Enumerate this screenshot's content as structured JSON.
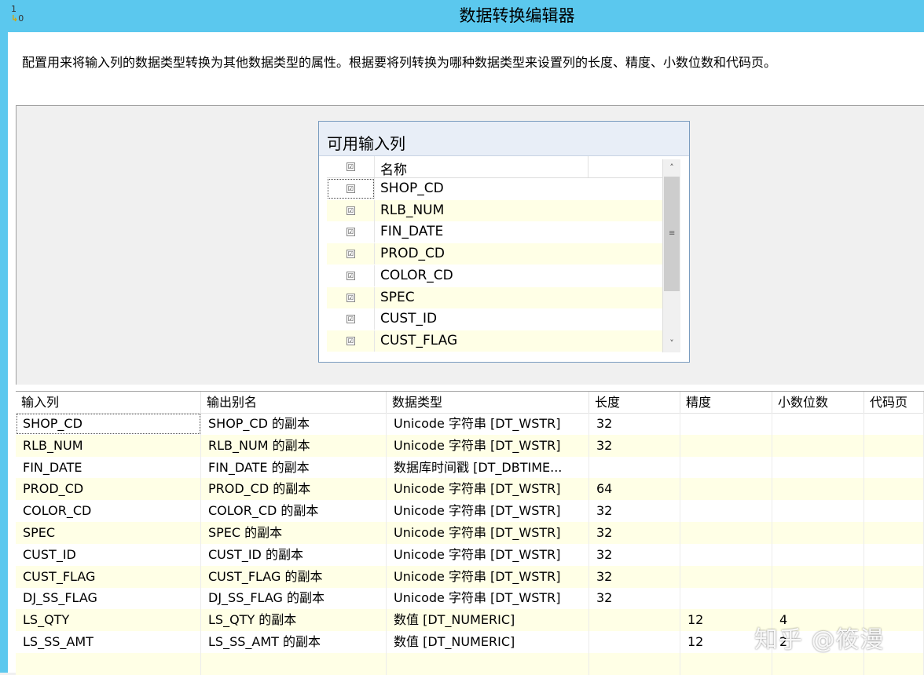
{
  "window": {
    "title": "数据转换编辑器",
    "icon_label": "1",
    "icon_sub": "0"
  },
  "description": "配置用来将输入列的数据类型转换为其他数据类型的属性。根据要将列转换为哪种数据类型来设置列的长度、精度、小数位数和代码页。",
  "available_inputs": {
    "title": "可用输入列",
    "header_name": "名称",
    "check_mark": "☑",
    "items": [
      "SHOP_CD",
      "RLB_NUM",
      "FIN_DATE",
      "PROD_CD",
      "COLOR_CD",
      "SPEC",
      "CUST_ID",
      "CUST_FLAG"
    ],
    "scroll_up": "˄",
    "scroll_down": "˅",
    "scroll_grip": "≡"
  },
  "grid": {
    "columns": [
      "输入列",
      "输出别名",
      "数据类型",
      "长度",
      "精度",
      "小数位数",
      "代码页"
    ],
    "rows": [
      [
        "SHOP_CD",
        "SHOP_CD 的副本",
        "Unicode 字符串 [DT_WSTR]",
        "32",
        "",
        "",
        ""
      ],
      [
        "RLB_NUM",
        "RLB_NUM 的副本",
        "Unicode 字符串 [DT_WSTR]",
        "32",
        "",
        "",
        ""
      ],
      [
        "FIN_DATE",
        "FIN_DATE 的副本",
        "数据库时间戳 [DT_DBTIME...",
        "",
        "",
        "",
        ""
      ],
      [
        "PROD_CD",
        "PROD_CD 的副本",
        "Unicode 字符串 [DT_WSTR]",
        "64",
        "",
        "",
        ""
      ],
      [
        "COLOR_CD",
        "COLOR_CD 的副本",
        "Unicode 字符串 [DT_WSTR]",
        "32",
        "",
        "",
        ""
      ],
      [
        "SPEC",
        "SPEC 的副本",
        "Unicode 字符串 [DT_WSTR]",
        "32",
        "",
        "",
        ""
      ],
      [
        "CUST_ID",
        "CUST_ID 的副本",
        "Unicode 字符串 [DT_WSTR]",
        "32",
        "",
        "",
        ""
      ],
      [
        "CUST_FLAG",
        "CUST_FLAG 的副本",
        "Unicode 字符串 [DT_WSTR]",
        "32",
        "",
        "",
        ""
      ],
      [
        "DJ_SS_FLAG",
        "DJ_SS_FLAG 的副本",
        "Unicode 字符串 [DT_WSTR]",
        "32",
        "",
        "",
        ""
      ],
      [
        "LS_QTY",
        "LS_QTY 的副本",
        "数值 [DT_NUMERIC]",
        "",
        "12",
        "4",
        ""
      ],
      [
        "LS_SS_AMT",
        "LS_SS_AMT 的副本",
        "数值 [DT_NUMERIC]",
        "",
        "12",
        "2",
        ""
      ]
    ]
  },
  "watermark": "知乎 @筱漫",
  "colors": {
    "titlebar": "#5bc8ee",
    "alt_row": "#ffffe6"
  }
}
